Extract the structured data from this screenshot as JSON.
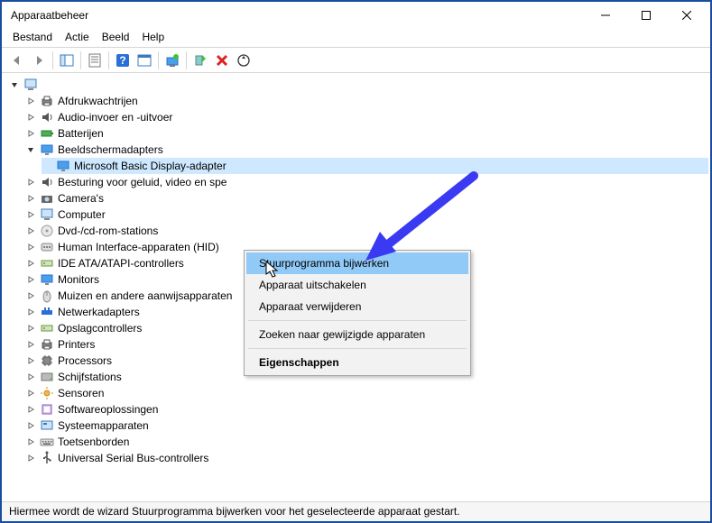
{
  "titlebar": {
    "title": "Apparaatbeheer"
  },
  "menubar": {
    "file": "Bestand",
    "action": "Actie",
    "view": "Beeld",
    "help": "Help"
  },
  "tree": {
    "root_icon": "computer-icon",
    "categories": [
      {
        "icon": "print-queue-icon",
        "label": "Afdrukwachtrijen"
      },
      {
        "icon": "audio-icon",
        "label": "Audio-invoer en -uitvoer"
      },
      {
        "icon": "battery-icon",
        "label": "Batterijen"
      },
      {
        "icon": "display-icon",
        "label": "Beeldschermadapters",
        "expanded": true,
        "children": [
          {
            "icon": "display-icon",
            "label": "Microsoft Basic Display-adapter",
            "selected": true
          }
        ]
      },
      {
        "icon": "sound-icon",
        "label": "Besturing voor geluid, video en spe"
      },
      {
        "icon": "camera-icon",
        "label": "Camera's"
      },
      {
        "icon": "computer-icon",
        "label": "Computer"
      },
      {
        "icon": "dvd-icon",
        "label": "Dvd-/cd-rom-stations"
      },
      {
        "icon": "hid-icon",
        "label": "Human Interface-apparaten (HID)"
      },
      {
        "icon": "ide-icon",
        "label": "IDE ATA/ATAPI-controllers"
      },
      {
        "icon": "monitor-icon",
        "label": "Monitors"
      },
      {
        "icon": "mouse-icon",
        "label": "Muizen en andere aanwijsapparaten"
      },
      {
        "icon": "network-icon",
        "label": "Netwerkadapters"
      },
      {
        "icon": "storage-icon",
        "label": "Opslagcontrollers"
      },
      {
        "icon": "printer-icon",
        "label": "Printers"
      },
      {
        "icon": "processor-icon",
        "label": "Processors"
      },
      {
        "icon": "disk-icon",
        "label": "Schijfstations"
      },
      {
        "icon": "sensor-icon",
        "label": "Sensoren"
      },
      {
        "icon": "software-icon",
        "label": "Softwareoplossingen"
      },
      {
        "icon": "system-icon",
        "label": "Systeemapparaten"
      },
      {
        "icon": "keyboard-icon",
        "label": "Toetsenborden"
      },
      {
        "icon": "usb-icon",
        "label": "Universal Serial Bus-controllers"
      }
    ]
  },
  "contextmenu": {
    "update_driver": "Stuurprogramma bijwerken",
    "disable_device": "Apparaat uitschakelen",
    "uninstall_device": "Apparaat verwijderen",
    "scan_changes": "Zoeken naar gewijzigde apparaten",
    "properties": "Eigenschappen"
  },
  "statusbar": {
    "text": "Hiermee wordt de wizard Stuurprogramma bijwerken voor het geselecteerde apparaat gestart."
  }
}
